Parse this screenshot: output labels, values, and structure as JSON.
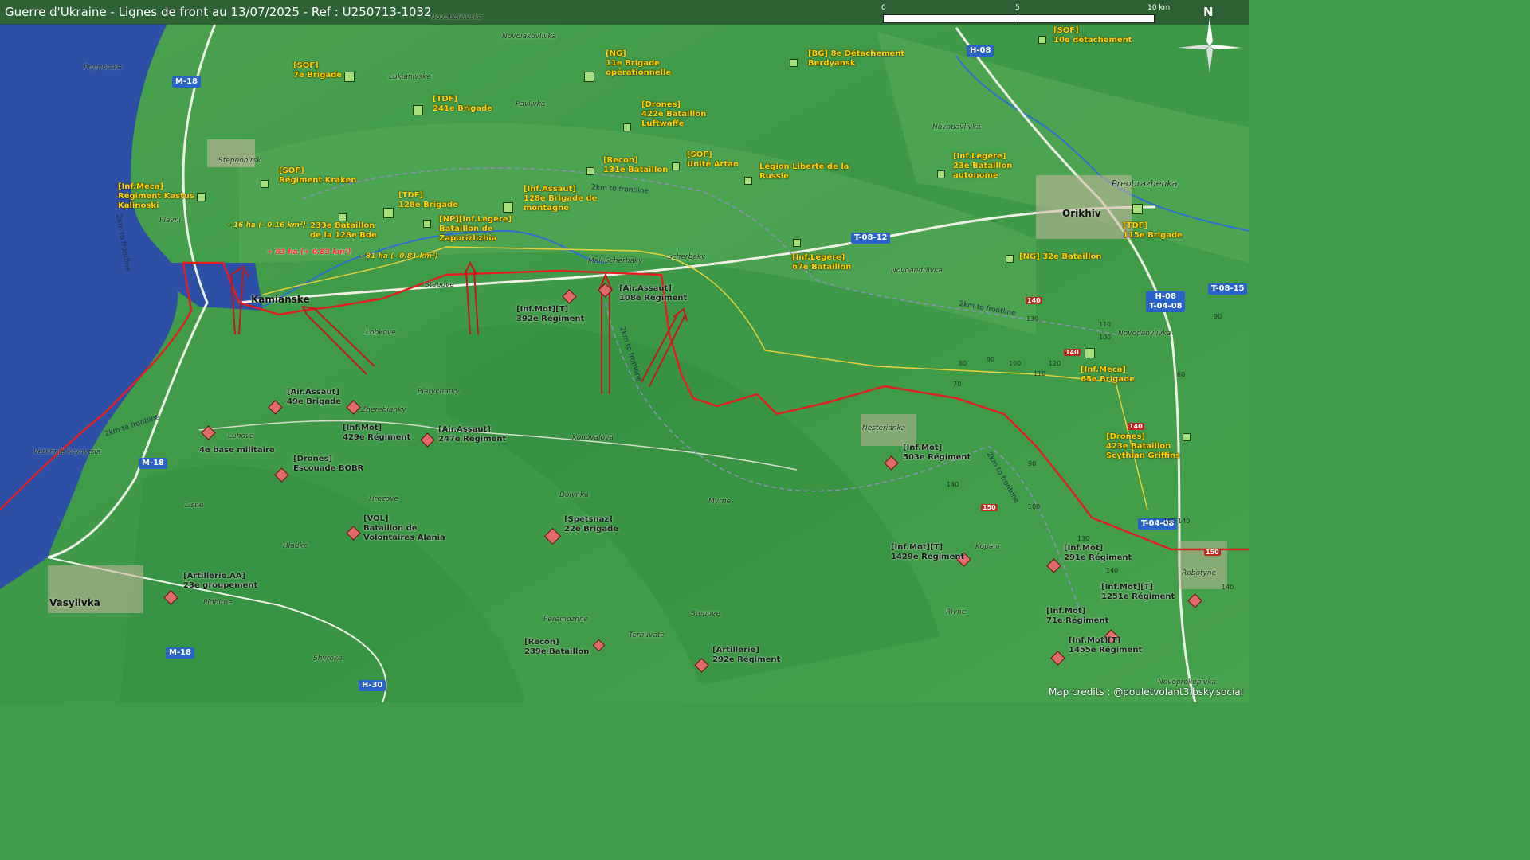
{
  "title": "Guerre d'Ukraine - Lignes de front au 13/07/2025 - Ref : U250713-1032",
  "scale_bar": {
    "labels": [
      "0",
      "5",
      "10 km"
    ]
  },
  "north_label": "N",
  "credits": "Map credits : @pouletvolant3.bsky.social",
  "colors": {
    "ua_units": "#ffd200",
    "ru_units": "#1b1b1b",
    "front_line": "#e02020",
    "road_badge": "#2a62c8",
    "water": "#2d4fa5"
  },
  "places": [
    {
      "name": "Novoiakovlivka"
    },
    {
      "name": "Novoboikivske"
    },
    {
      "name": "Prymorske"
    },
    {
      "name": "Lukianivske"
    },
    {
      "name": "Pavlivka"
    },
    {
      "name": "Stepnohirsk"
    },
    {
      "name": "Plavni"
    },
    {
      "name": "Kamianske"
    },
    {
      "name": "Stepove"
    },
    {
      "name": "Lobkove"
    },
    {
      "name": "Mali Scherbaky"
    },
    {
      "name": "Scherbaky"
    },
    {
      "name": "Piatykhatky"
    },
    {
      "name": "Zherebianky"
    },
    {
      "name": "Luhove"
    },
    {
      "name": "Verkhnia Krynytsia"
    },
    {
      "name": "Konovalova"
    },
    {
      "name": "Lisne"
    },
    {
      "name": "Hrozove"
    },
    {
      "name": "Dolynka"
    },
    {
      "name": "Myrne"
    },
    {
      "name": "Hladke"
    },
    {
      "name": "Vasylivka"
    },
    {
      "name": "Pidhirne"
    },
    {
      "name": "Peremozhne"
    },
    {
      "name": "Shyroke"
    },
    {
      "name": "Ternuvate"
    },
    {
      "name": "Stepove"
    },
    {
      "name": "Novopavlivka"
    },
    {
      "name": "Preobrazhenka"
    },
    {
      "name": "Orikhiv"
    },
    {
      "name": "Novoandriivka"
    },
    {
      "name": "Novodanylivka"
    },
    {
      "name": "Nesterianka"
    },
    {
      "name": "Kopani"
    },
    {
      "name": "Robotyne"
    },
    {
      "name": "Rivne"
    },
    {
      "name": "Novoprokopivka"
    }
  ],
  "roads": [
    {
      "label": "M-18"
    },
    {
      "label": "M-18"
    },
    {
      "label": "M-18"
    },
    {
      "label": "H-30"
    },
    {
      "label": "H-08"
    },
    {
      "label": "T-08-12"
    },
    {
      "label": "T-08-15"
    },
    {
      "label": "H-08\nT-04-08"
    },
    {
      "label": "T-04-08"
    }
  ],
  "route_numbers": [
    "140",
    "140",
    "150",
    "150",
    "140"
  ],
  "elevations": [
    "130",
    "110",
    "90",
    "100",
    "80",
    "90",
    "100",
    "110",
    "120",
    "70",
    "60",
    "140",
    "100",
    "90",
    "130",
    "140",
    "150",
    "140",
    "140"
  ],
  "frontline_labels": [
    "2km to frontline",
    "2km to frontline",
    "2km to frontline",
    "2km to frontline",
    "2km to frontline",
    "2km to frontline"
  ],
  "annotations": [
    {
      "text": "- 16 ha (- 0.16 km²)",
      "kind": "loss"
    },
    {
      "text": "+ 83 ha (+ 0.83 km²)",
      "kind": "gain"
    },
    {
      "text": "- 81 ha (- 0.81 km²)",
      "kind": "loss"
    }
  ],
  "ua_units": [
    {
      "text": "[SOF]\n7e Brigade"
    },
    {
      "text": "[TDF]\n241e Brigade"
    },
    {
      "text": "[NG]\n11e Brigade\nopérationnelle"
    },
    {
      "text": "[Drones]\n422e Bataillon\nLuftwaffe"
    },
    {
      "text": "[BG] 8e Détachement\nBerdyansk"
    },
    {
      "text": "[SOF]\n10e détachement"
    },
    {
      "text": "[SOF]\nRégiment Kraken"
    },
    {
      "text": "[Inf.Meca]\nRégiment Kastus\nKalinoski"
    },
    {
      "text": "[Recon]\n131e Bataillon"
    },
    {
      "text": "[SOF]\nUnité Artan"
    },
    {
      "text": "Légion Liberté de la\nRussie"
    },
    {
      "text": "[Inf.Légère]\n23e Bataillon\nautonome"
    },
    {
      "text": "[TDF]\n128e Brigade"
    },
    {
      "text": "[Inf.Assaut]\n128e Brigade de\nmontagne"
    },
    {
      "text": "233e Bataillon\nde la 128e Bde"
    },
    {
      "text": "[NP][Inf.Légère]\nBataillon de\nZaporizhzhia"
    },
    {
      "text": "[Inf.Légère]\n67e Bataillon"
    },
    {
      "text": "[TDF]\n115e Brigade"
    },
    {
      "text": "[NG] 32e Bataillon"
    },
    {
      "text": "[Inf.Meca]\n65e Brigade"
    },
    {
      "text": "[Drones]\n423e Bataillon\nScythian Griffins"
    }
  ],
  "ru_units": [
    {
      "text": "[Air.Assaut]\n108e Régiment"
    },
    {
      "text": "[Inf.Mot][T]\n392e Régiment"
    },
    {
      "text": "[Air.Assaut]\n49e Brigade"
    },
    {
      "text": "[Inf.Mot]\n429e Régiment"
    },
    {
      "text": "[Air.Assaut]\n247e Régiment"
    },
    {
      "text": "4e base militaire"
    },
    {
      "text": "[Drones]\nEscouade BOBR"
    },
    {
      "text": "[VOL]\nBataillon de\nVolontaires Alania"
    },
    {
      "text": "[Spetsnaz]\n22e Brigade"
    },
    {
      "text": "[Artillerie.AA]\n23e groupement"
    },
    {
      "text": "[Recon]\n239e Bataillon"
    },
    {
      "text": "[Artillerie]\n292e Régiment"
    },
    {
      "text": "[Inf.Mot]\n503e Régiment"
    },
    {
      "text": "[Inf.Mot][T]\n1429e Régiment"
    },
    {
      "text": "[Inf.Mot]\n291e Régiment"
    },
    {
      "text": "[Inf.Mot][T]\n1251e Régiment"
    },
    {
      "text": "[Inf.Mot]\n71e Régiment"
    },
    {
      "text": "[Inf.Mot][T]\n1455e Régiment"
    }
  ]
}
